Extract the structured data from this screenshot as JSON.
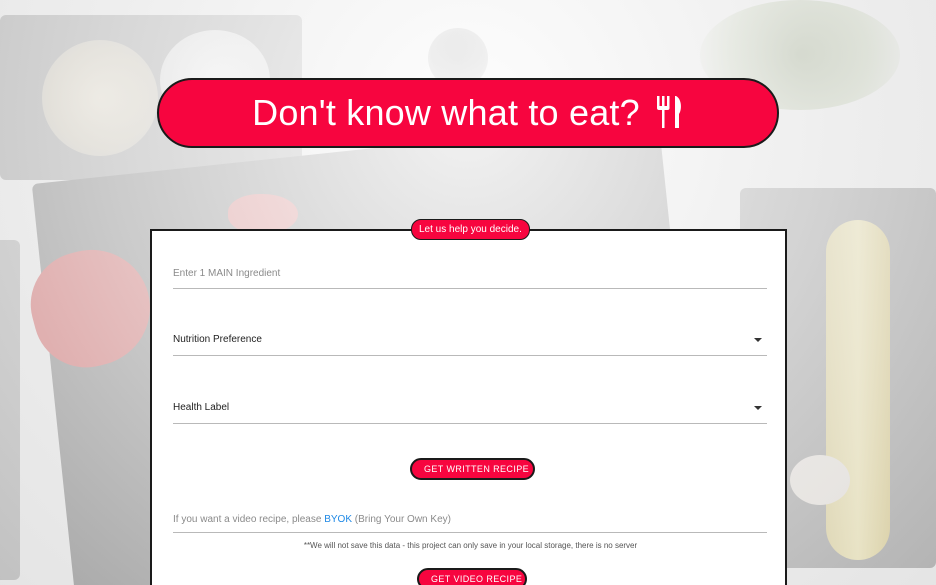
{
  "header": {
    "title": "Don't know what to eat?",
    "icon": "utensils-icon"
  },
  "form": {
    "tagline": "Let us help you decide.",
    "ingredient_placeholder": "Enter 1 MAIN Ingredient",
    "nutrition_select_label": "Nutrition Preference",
    "health_select_label": "Health Label",
    "written_button": "GET WRITTEN RECIPE",
    "video_prompt_prefix": "If you want a video recipe, please",
    "video_prompt_link": "BYOK",
    "video_prompt_suffix": "(Bring Your Own Key)",
    "privacy_note": "**We will not save this data - this project can only save in your local storage, there is no server",
    "video_button": "GET VIDEO RECIPE"
  },
  "colors": {
    "accent": "#f7053f",
    "link": "#1e88e5",
    "border": "#1a1a1a"
  }
}
